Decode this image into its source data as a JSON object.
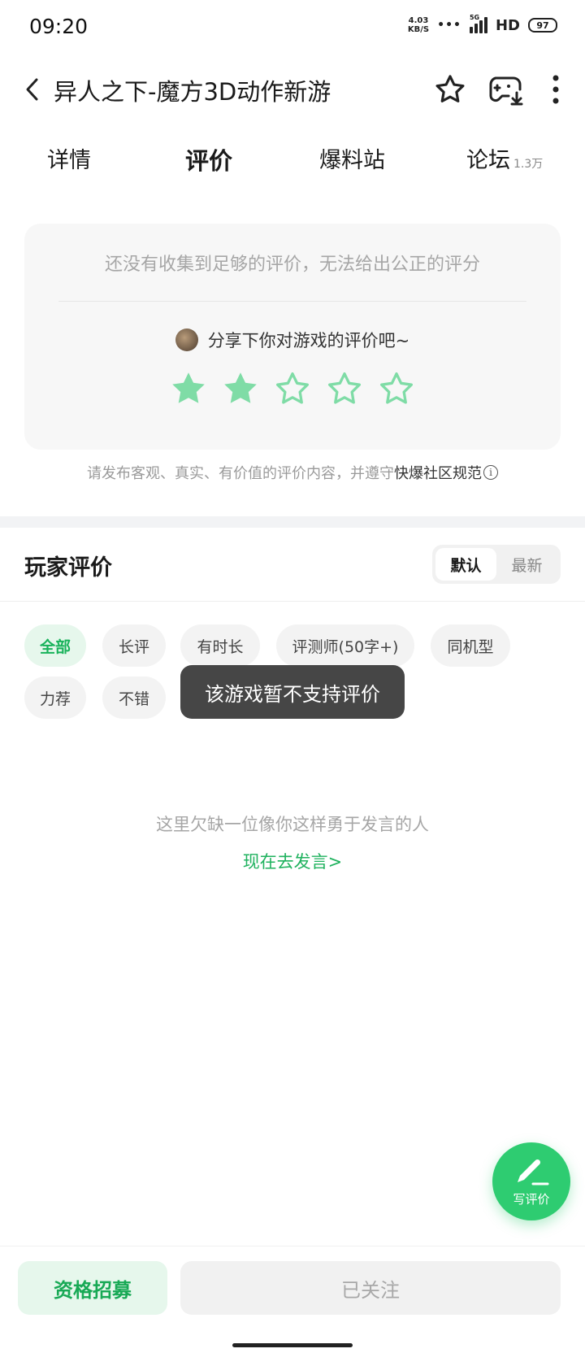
{
  "status_bar": {
    "time": "09:20",
    "net_speed_value": "4.03",
    "net_speed_unit": "KB/S",
    "signal_label": "5G",
    "hd_label": "HD",
    "battery": "97"
  },
  "header": {
    "title": "异人之下-魔方3D动作新游"
  },
  "tabs": [
    {
      "label": "详情"
    },
    {
      "label": "评价",
      "active": true
    },
    {
      "label": "爆料站"
    },
    {
      "label": "论坛",
      "count": "1.3万"
    }
  ],
  "rating_card": {
    "notice": "还没有收集到足够的评价，无法给出公正的评分",
    "share_prompt": "分享下你对游戏的评价吧~",
    "stars_filled": 2,
    "stars_total": 5
  },
  "guideline": {
    "text": "请发布客观、真实、有价值的评价内容，并遵守",
    "link": "快爆社区规范",
    "info_icon": "i"
  },
  "player_reviews": {
    "title": "玩家评价",
    "sort_options": [
      "默认",
      "最新"
    ],
    "sort_selected": "默认",
    "filters": [
      "全部",
      "长评",
      "有时长",
      "评测师(50字+)",
      "同机型",
      "力荐",
      "不错"
    ],
    "active_filter": "全部"
  },
  "toast": "该游戏暂不支持评价",
  "empty_state": {
    "message": "这里欠缺一位像你这样勇于发言的人",
    "action": "现在去发言>"
  },
  "fab": {
    "label": "写评价"
  },
  "bottom_bar": {
    "recruit": "资格招募",
    "follow": "已关注"
  },
  "colors": {
    "accent_green": "#2ecc71",
    "star_filled": "#7fdca6"
  }
}
